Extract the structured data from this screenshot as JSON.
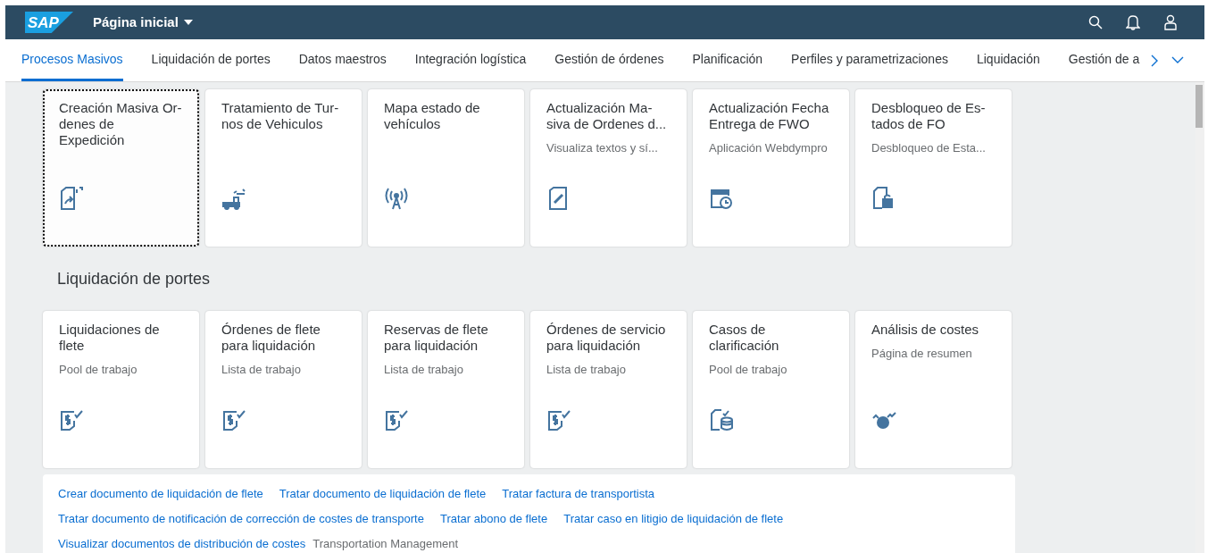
{
  "shell": {
    "logo": "SAP",
    "title": "Página inicial"
  },
  "tabs": [
    {
      "label": "Procesos Masivos",
      "selected": true
    },
    {
      "label": "Liquidación de portes",
      "selected": false
    },
    {
      "label": "Datos maestros",
      "selected": false
    },
    {
      "label": "Integración logística",
      "selected": false
    },
    {
      "label": "Gestión de órdenes",
      "selected": false
    },
    {
      "label": "Planificación",
      "selected": false
    },
    {
      "label": "Perfiles y parametrizaciones",
      "selected": false
    },
    {
      "label": "Liquidación",
      "selected": false
    },
    {
      "label": "Gestión de a",
      "selected": false
    }
  ],
  "sections": [
    {
      "tiles": [
        {
          "title": "Creación Masiva Or-\ndenes de\nExpedición",
          "focused": true
        },
        {
          "title": "Tratamiento de Tur-\nnos de Vehiculos",
          "focused": false
        },
        {
          "title": "Mapa estado de\nvehículos",
          "focused": false
        },
        {
          "title": "Actualización Ma-\nsiva de Ordenes d...",
          "subtitle": "Visualiza textos y sí...",
          "focused": false
        },
        {
          "title": "Actualización Fecha\nEntrega de FWO",
          "subtitle": "Aplicación Webdympro",
          "focused": false
        },
        {
          "title": "Desbloqueo de Es-\ntados de FO",
          "subtitle": "Desbloqueo de Esta...",
          "focused": false
        }
      ]
    },
    {
      "heading": "Liquidación de portes",
      "tiles": [
        {
          "title": "Liquidaciones de\nflete",
          "subtitle": "Pool de trabajo",
          "focused": false
        },
        {
          "title": "Órdenes de flete\npara liquidación",
          "subtitle": "Lista de trabajo",
          "focused": false
        },
        {
          "title": "Reservas de flete\npara liquidación",
          "subtitle": "Lista de trabajo",
          "focused": false
        },
        {
          "title": "Órdenes de servicio\npara liquidación",
          "subtitle": "Lista de trabajo",
          "focused": false
        },
        {
          "title": "Casos de\nclarificación",
          "subtitle": "Pool de trabajo",
          "focused": false
        },
        {
          "title": "Análisis de costes",
          "subtitle": "Página de resumen",
          "focused": false
        }
      ],
      "links": [
        [
          {
            "kind": "link",
            "text": "Crear documento de liquidación de flete"
          },
          {
            "kind": "link",
            "text": "Tratar documento de liquidación de flete"
          },
          {
            "kind": "link",
            "text": "Tratar factura de transportista"
          }
        ],
        [
          {
            "kind": "link",
            "text": "Tratar documento de notificación de corrección de costes de transporte"
          },
          {
            "kind": "link",
            "text": "Tratar abono de flete"
          },
          {
            "kind": "link",
            "text": "Tratar caso en litigio de liquidación de flete"
          }
        ],
        [
          {
            "kind": "link",
            "text": "Visualizar documentos de distribución de costes"
          },
          {
            "kind": "text",
            "text": "Transportation Management"
          }
        ]
      ]
    }
  ]
}
